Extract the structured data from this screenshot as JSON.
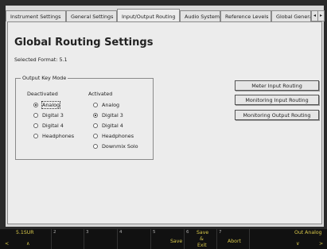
{
  "tabs": [
    {
      "label": "Instrument Settings"
    },
    {
      "label": "General Settings"
    },
    {
      "label": "Input/Output Routing"
    },
    {
      "label": "Audio System"
    },
    {
      "label": "Reference Levels"
    },
    {
      "label": "Global Generato"
    }
  ],
  "tab_arrows": {
    "left": "◂",
    "right": "▸"
  },
  "page": {
    "title": "Global Routing Settings",
    "selected_format": "Selected Format: 5.1"
  },
  "output_key_mode": {
    "label": "Output Key Mode",
    "deactivated": {
      "header": "Deactivated",
      "options": [
        "Analog",
        "Digital 3",
        "Digital 4",
        "Headphones"
      ]
    },
    "activated": {
      "header": "Activated",
      "options": [
        "Analog",
        "Digital 3",
        "Digital 4",
        "Headphones",
        "Downmix Solo"
      ]
    }
  },
  "buttons": {
    "meter_input_routing": "Meter Input Routing",
    "monitoring_input_routing": "Monitoring Input Routing",
    "monitoring_output_routing": "Monitoring Output Routing"
  },
  "softkeys": {
    "k1": {
      "num": "",
      "top": "5.1SUR",
      "bottom": "<",
      "bottom2": "∧"
    },
    "k2": {
      "num": "2"
    },
    "k3": {
      "num": "3"
    },
    "k4": {
      "num": "4"
    },
    "k5": {
      "num": "5",
      "label": "Save"
    },
    "k6": {
      "num": "6",
      "label": "Save & Exit",
      "top_label": "Save",
      "amp": "&",
      "exit": "Exit"
    },
    "k7": {
      "num": "7",
      "label": "Abort"
    },
    "k8": {
      "num": "",
      "top": "Out Analog",
      "bottom": "∨",
      "bottom2": ">"
    }
  }
}
